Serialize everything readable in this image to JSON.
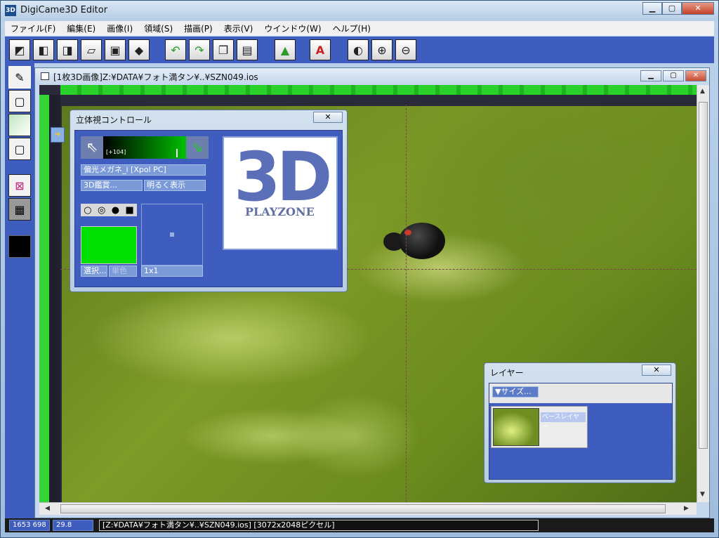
{
  "app": {
    "title": "DigiCame3D Editor",
    "icon_label": "3D",
    "minimize": "▁",
    "maximize": "▢",
    "close": "✕"
  },
  "menu": [
    "ファイル(F)",
    "編集(E)",
    "画像(I)",
    "領域(S)",
    "描画(P)",
    "表示(V)",
    "ウインドウ(W)",
    "ヘルプ(H)"
  ],
  "toolbar_icons": [
    "new-icon",
    "copy-icon",
    "paste-icon",
    "open-icon",
    "save-icon",
    "print-icon",
    "undo-icon",
    "redo-icon",
    "duplicate-icon",
    "clipboard-icon",
    "upload-icon",
    "text-icon",
    "stereo-view-icon",
    "zoom-in-icon",
    "zoom-out-icon"
  ],
  "document": {
    "title": "[1枚3D画像]Z:¥DATA¥フォト満タン¥..¥SZN049.ios",
    "minimize": "▁",
    "maximize": "▢",
    "close": "✕"
  },
  "stereo_panel": {
    "title": "立体視コントロール",
    "close": "✕",
    "value": "[+104]",
    "glasses_button": "偏光メガネ_i [Xpol PC]",
    "view_button": "3D鑑賞...",
    "bright_button": "明るく表示",
    "select_button": "選択...",
    "mono_button": "単色",
    "scale_field": "1x1",
    "logo_text": "3D",
    "logo_sub": "PLAYZONE"
  },
  "layer_panel": {
    "title": "レイヤー",
    "close": "✕",
    "size_button": "▼サイズ...",
    "layer_name": "ベースレイヤー"
  },
  "status": {
    "coords": "1653 698",
    "value": "29.8",
    "message": "[Z:¥DATA¥フォト満タン¥..¥SZN049.ios] [3072x2048ピクセル]"
  },
  "colors": {
    "accent_blue": "#3f5dbf",
    "ruler_green": "#2bd12b",
    "swatch_green": "#00e000"
  }
}
